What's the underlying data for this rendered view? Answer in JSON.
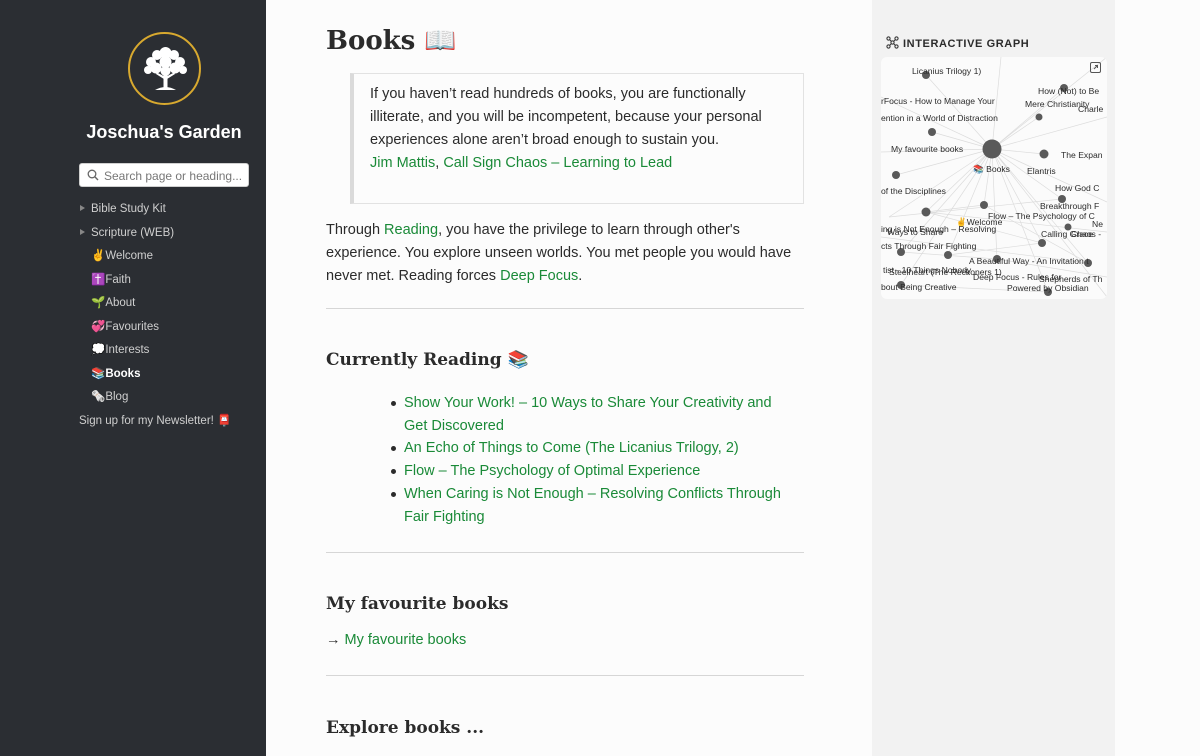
{
  "sidebar": {
    "site_title": "Joschua's Garden",
    "search_placeholder": "Search page or heading...",
    "items": [
      {
        "label": "Bible Study Kit",
        "type": "folder"
      },
      {
        "label": "Scripture (WEB)",
        "type": "folder"
      },
      {
        "label": "✌️Welcome",
        "type": "page"
      },
      {
        "label": "✝️Faith",
        "type": "page"
      },
      {
        "label": "🌱About",
        "type": "page"
      },
      {
        "label": "💞Favourites",
        "type": "page"
      },
      {
        "label": "💭Interests",
        "type": "page"
      },
      {
        "label": "📚Books",
        "type": "page",
        "active": true
      },
      {
        "label": "🗞️Blog",
        "type": "page"
      },
      {
        "label": "Sign up for my Newsletter! 📮",
        "type": "page"
      }
    ]
  },
  "main": {
    "title": "Books 📖",
    "quote": {
      "text": "If you haven’t read hundreds of books, you are functionally illiterate, and you will be incompetent, because your personal experiences alone aren’t broad enough to sustain you.",
      "author": "Jim Mattis",
      "separator": ", ",
      "source": "Call Sign Chaos – Learning to Lead"
    },
    "intro": {
      "before": "Through ",
      "link1": "Reading",
      "middle": ", you have the privilege to learn through other's experience. You explore unseen worlds. You met people you would have never met. Reading forces ",
      "link2": "Deep Focus",
      "after": "."
    },
    "currently_reading": {
      "heading": "Currently Reading 📚",
      "items": [
        "Show Your Work! – 10 Ways to Share Your Creativity and Get Discovered",
        "An Echo of Things to Come (The Licanius Trilogy, 2)",
        "Flow – The Psychology of Optimal Experience",
        "When Caring is Not Enough – Resolving Conflicts Through Fair Fighting"
      ]
    },
    "favourite_books": {
      "heading": "My favourite books",
      "arrow": "→ ",
      "link": "My favourite books"
    },
    "explore": {
      "heading": "Explore books ..."
    }
  },
  "graph_panel": {
    "title": "INTERACTIVE GRAPH",
    "labels": [
      "Licanius Trilogy 1)",
      "How (Not) to Be",
      "Mere Christianity",
      "Charle",
      "rFocus - How to Manage Your",
      "ention in a World of Distraction",
      "My favourite books",
      "📚 Books",
      "Elantris",
      "The Expan",
      "of the Disciplines",
      "How God C",
      "Breakthrough F",
      "Flow – The Psychology of C",
      "✌️Welcome",
      "ing is Not Enough – Resolving",
      "Ways to Share",
      "Ne",
      "Calling Grace",
      "Chaos -",
      "cts Through Fair Fighting",
      "A Beautiful Way - An Invitation t",
      "tist - 10 Things Nobody",
      "Steelheart (The Reckoners 1)",
      "Deep Focus - Rules for",
      "Shepherds of Th",
      "bout Being Creative",
      "Powered by Obsidian"
    ]
  }
}
